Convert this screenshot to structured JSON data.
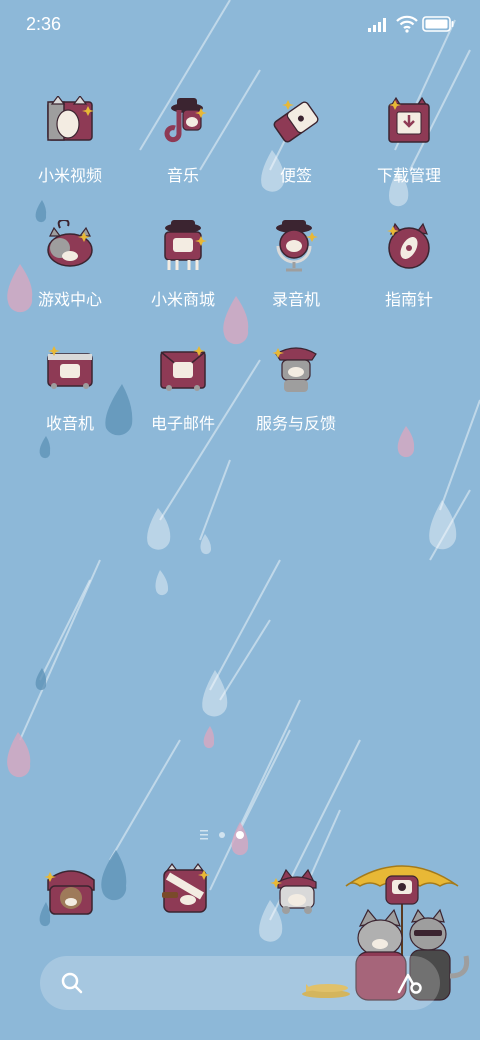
{
  "status_bar": {
    "time": "2:36"
  },
  "apps": [
    {
      "label": "小米视频",
      "icon": "video-cat-icon"
    },
    {
      "label": "音乐",
      "icon": "music-cat-icon"
    },
    {
      "label": "便签",
      "icon": "notes-cat-icon"
    },
    {
      "label": "下载管理",
      "icon": "download-cat-icon"
    },
    {
      "label": "游戏中心",
      "icon": "game-cat-icon"
    },
    {
      "label": "小米商城",
      "icon": "store-cat-icon"
    },
    {
      "label": "录音机",
      "icon": "recorder-cat-icon"
    },
    {
      "label": "指南针",
      "icon": "compass-cat-icon"
    },
    {
      "label": "收音机",
      "icon": "radio-cat-icon"
    },
    {
      "label": "电子邮件",
      "icon": "email-cat-icon"
    },
    {
      "label": "服务与反馈",
      "icon": "feedback-cat-icon"
    }
  ],
  "dock": [
    {
      "icon": "phone-cat-icon"
    },
    {
      "icon": "messages-cat-icon"
    },
    {
      "icon": "browser-cat-icon"
    },
    {
      "icon": "camera-cat-icon"
    }
  ],
  "colors": {
    "background": "#8db8d8",
    "icon_maroon": "#8e3a55",
    "icon_cream": "#f3ece2",
    "accent_gold": "#e8b836"
  }
}
